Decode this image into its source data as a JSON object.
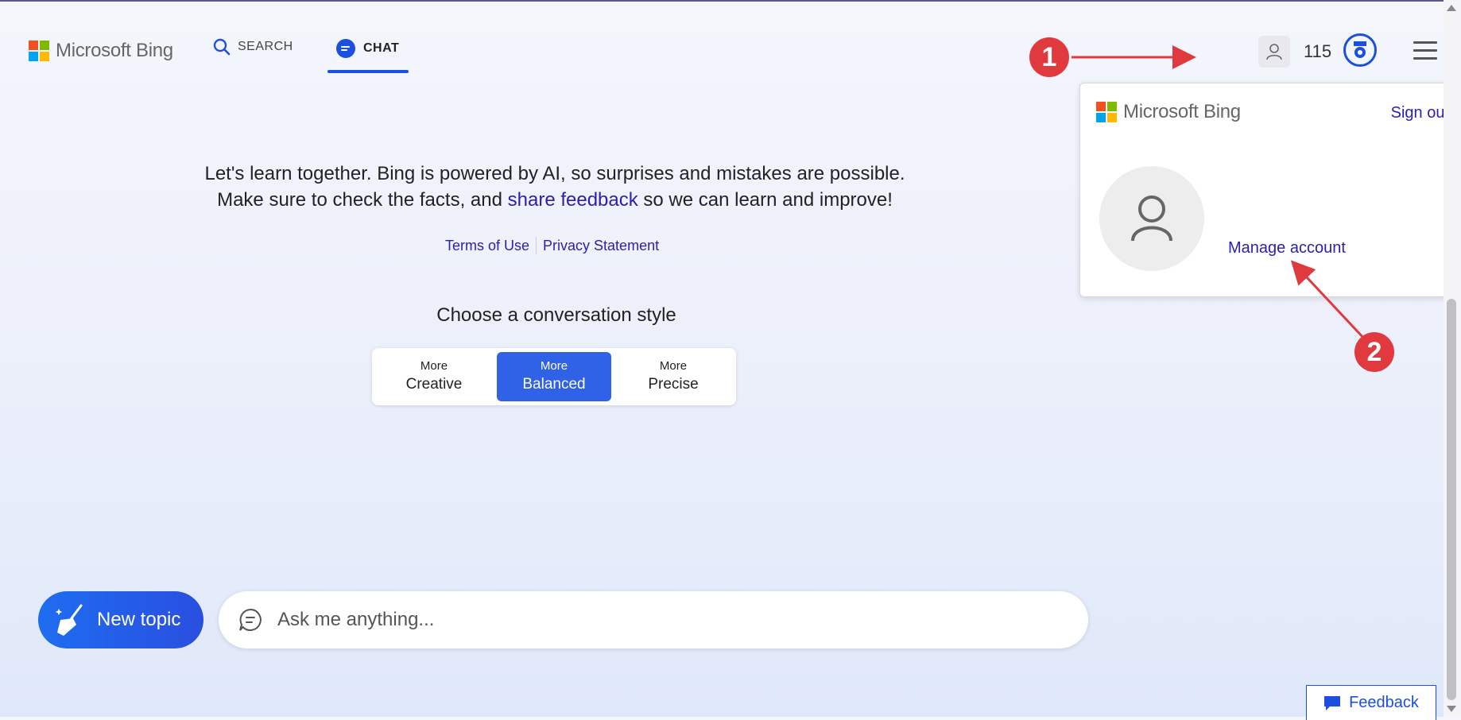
{
  "header": {
    "brand": "Microsoft Bing",
    "nav": [
      {
        "label": "SEARCH",
        "icon": "search-icon"
      },
      {
        "label": "CHAT",
        "icon": "chat-icon",
        "active": true
      }
    ],
    "points": "115"
  },
  "account_popup": {
    "brand": "Microsoft Bing",
    "sign_out": "Sign out",
    "manage_account": "Manage account"
  },
  "intro": {
    "line1": "Let's learn together. Bing is powered by AI, so surprises and mistakes are possible.",
    "line2_pre": "Make sure to check the facts, and ",
    "line2_link": "share feedback",
    "line2_post": " so we can learn and improve!"
  },
  "links": {
    "terms": "Terms of Use",
    "privacy": "Privacy Statement"
  },
  "conversation": {
    "heading": "Choose a conversation style",
    "styles": [
      {
        "top": "More",
        "label": "Creative"
      },
      {
        "top": "More",
        "label": "Balanced",
        "selected": true
      },
      {
        "top": "More",
        "label": "Precise"
      }
    ]
  },
  "composer": {
    "new_topic": "New topic",
    "placeholder": "Ask me anything..."
  },
  "feedback": "Feedback",
  "annotations": {
    "badge1": "1",
    "badge2": "2"
  },
  "colors": {
    "accent": "#1c4fe0",
    "link": "#2a1fae",
    "badge": "#e0393e"
  }
}
